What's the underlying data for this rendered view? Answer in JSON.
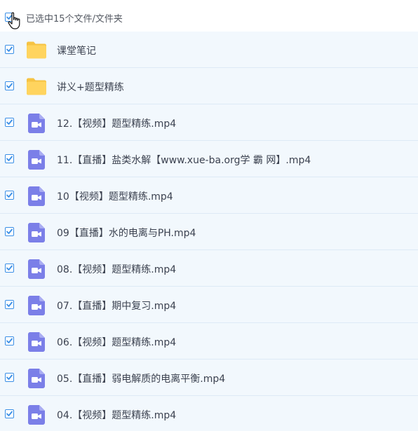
{
  "header": {
    "summary_text": "已选中15个文件/文件夹",
    "select_all_checked": true
  },
  "colors": {
    "accent": "#3b8fe6",
    "row_bg": "#f2f8fd",
    "folder": "#ffd45e",
    "video_icon": "#7b7fe8"
  },
  "files": [
    {
      "name": "课堂笔记",
      "type": "folder",
      "icon": "folder-icon",
      "checked": true
    },
    {
      "name": "讲义+题型精练",
      "type": "folder",
      "icon": "folder-icon",
      "checked": true
    },
    {
      "name": "12.【视频】题型精练.mp4",
      "type": "video",
      "icon": "video-file-icon",
      "checked": true
    },
    {
      "name": "11.【直播】盐类水解【www.xue-ba.org学 霸 网】.mp4",
      "type": "video",
      "icon": "video-file-icon",
      "checked": true
    },
    {
      "name": "10【视频】题型精练.mp4",
      "type": "video",
      "icon": "video-file-icon",
      "checked": true
    },
    {
      "name": "09【直播】水的电离与PH.mp4",
      "type": "video",
      "icon": "video-file-icon",
      "checked": true
    },
    {
      "name": "08.【视频】题型精练.mp4",
      "type": "video",
      "icon": "video-file-icon",
      "checked": true
    },
    {
      "name": "07.【直播】期中复习.mp4",
      "type": "video",
      "icon": "video-file-icon",
      "checked": true
    },
    {
      "name": "06.【视频】题型精练.mp4",
      "type": "video",
      "icon": "video-file-icon",
      "checked": true
    },
    {
      "name": "05.【直播】弱电解质的电离平衡.mp4",
      "type": "video",
      "icon": "video-file-icon",
      "checked": true
    },
    {
      "name": "04.【视频】题型精练.mp4",
      "type": "video",
      "icon": "video-file-icon",
      "checked": true
    }
  ]
}
